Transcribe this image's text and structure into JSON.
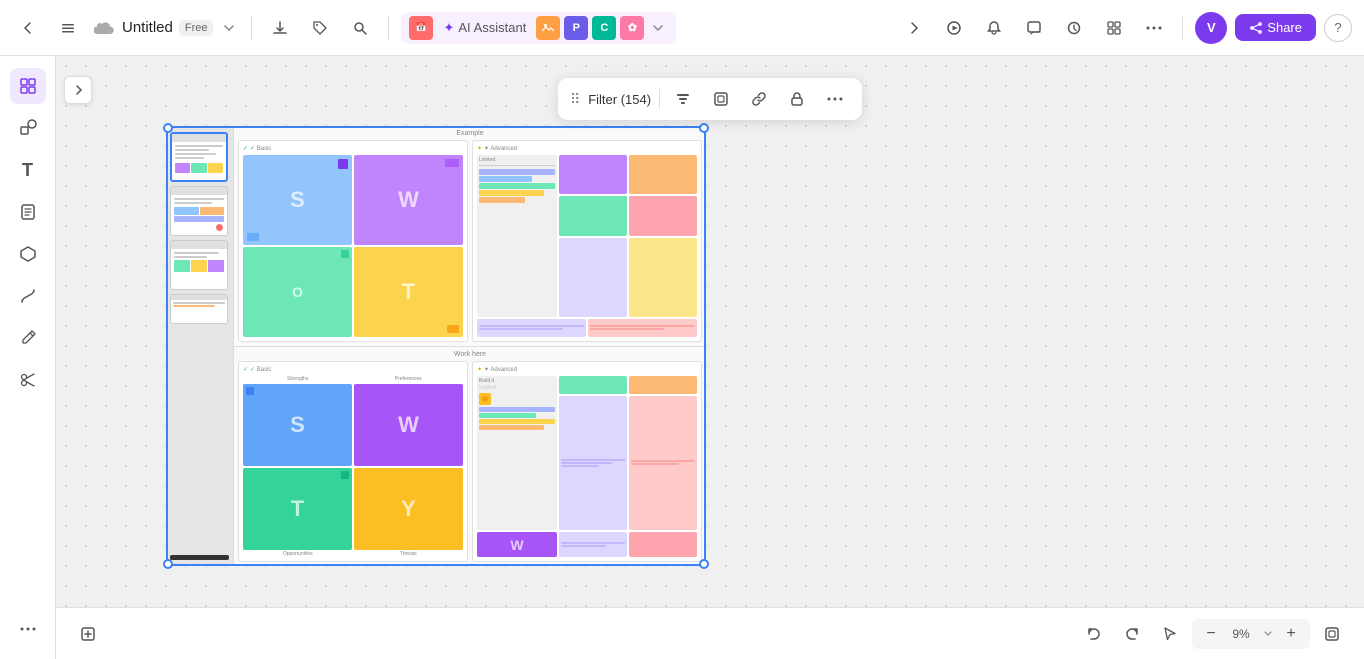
{
  "app": {
    "title": "Untitled",
    "plan": "Free",
    "avatar_initial": "V"
  },
  "toolbar": {
    "back_label": "‹",
    "menu_label": "☰",
    "download_label": "⬇",
    "tag_label": "🏷",
    "search_label": "🔍",
    "ai_assistant_label": "AI Assistant",
    "share_label": "Share",
    "help_label": "?",
    "expand_right": "›",
    "expand_left": "‹",
    "more_label": "⋯"
  },
  "filter_toolbar": {
    "label": "Filter (154)",
    "icon": "⠿",
    "actions": [
      "align-icon",
      "frame-icon",
      "link-icon",
      "lock-icon",
      "more-icon"
    ]
  },
  "sidebar": {
    "items": [
      {
        "name": "frames-icon",
        "icon": "⊡",
        "active": true
      },
      {
        "name": "shapes-icon",
        "icon": "◱"
      },
      {
        "name": "text-icon",
        "icon": "T"
      },
      {
        "name": "notes-icon",
        "icon": "🗒"
      },
      {
        "name": "objects-icon",
        "icon": "⬡"
      },
      {
        "name": "connectors-icon",
        "icon": "〜"
      },
      {
        "name": "pencil-icon",
        "icon": "✏"
      },
      {
        "name": "scissors-icon",
        "icon": "✂"
      },
      {
        "name": "more-icon",
        "icon": "⋯"
      }
    ]
  },
  "sections": {
    "top": {
      "title": "Example",
      "basic_label": "✓ Basic",
      "advanced_label": "✦ Advanced"
    },
    "bottom": {
      "title": "Work here",
      "basic_label": "✓ Basic",
      "advanced_label": "✦ Advanced"
    }
  },
  "bottom_toolbar": {
    "add_frame_label": "⊕",
    "undo_label": "↩",
    "redo_label": "↪",
    "pointer_label": "↖",
    "zoom_out_label": "−",
    "zoom_value": "9%",
    "zoom_in_label": "+",
    "fit_label": "⊡"
  },
  "colors": {
    "accent": "#7c3aed",
    "selection": "#3b82f6",
    "swot_blue": "#93c5fd",
    "swot_purple": "#c084fc",
    "swot_green": "#6ee7b7",
    "swot_yellow": "#fcd34d"
  }
}
